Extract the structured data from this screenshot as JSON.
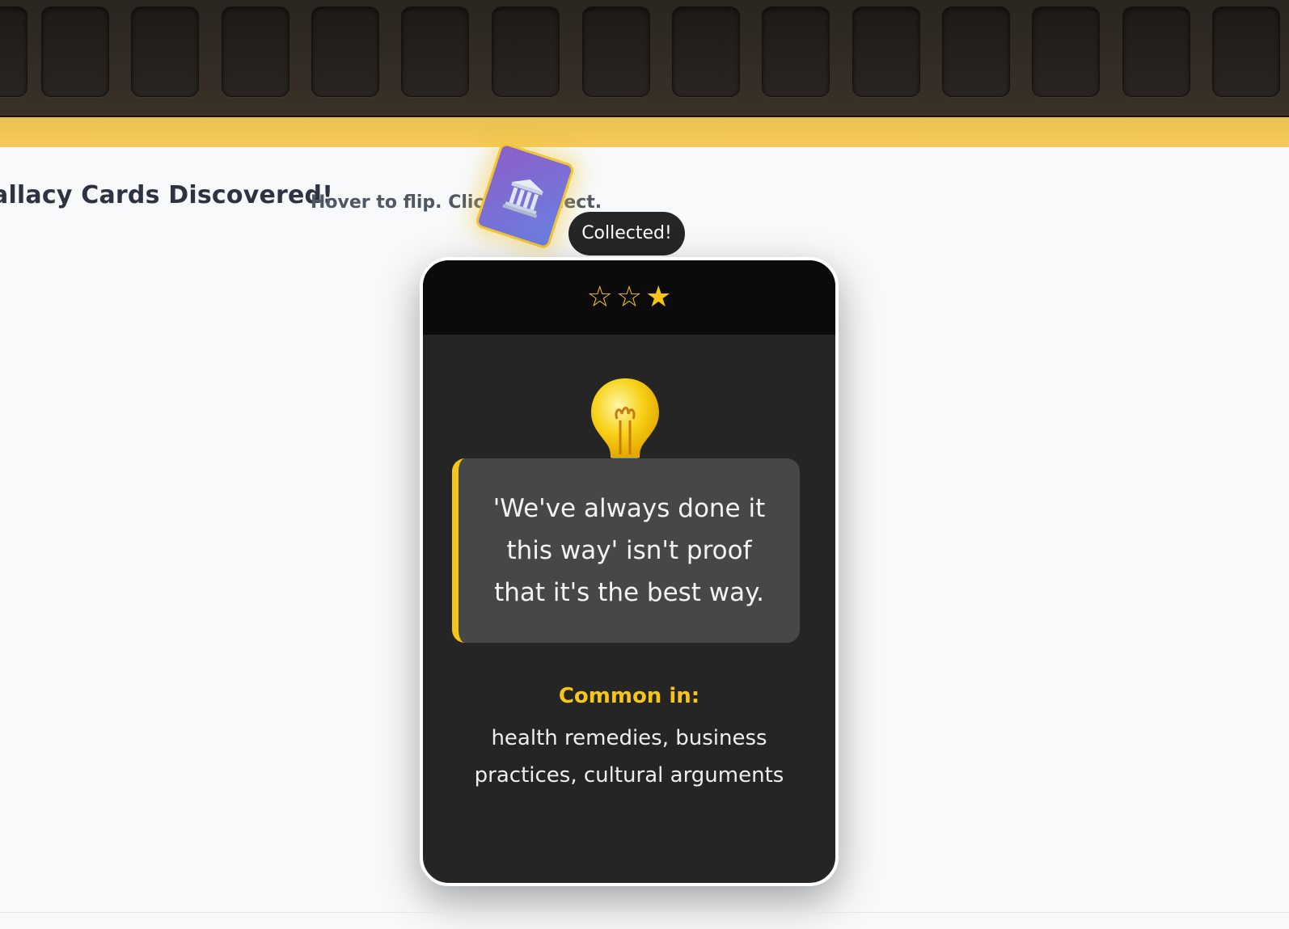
{
  "tray": {
    "slot_count": 15
  },
  "header": {
    "title": "allacy Cards Discovered!",
    "hint": "Hover to flip. Click to collect."
  },
  "mini_card": {
    "icon": "classical-building-icon",
    "accent_color": "#f2c531"
  },
  "tooltip": {
    "text": "Collected!"
  },
  "card": {
    "rating": {
      "filled": 1,
      "total": 3,
      "stars": [
        "☆",
        "☆",
        "★"
      ]
    },
    "icon": "light-bulb-icon",
    "quote": "'We've always done it this way' isn't proof that it's the best way.",
    "common_label": "Common in:",
    "common_text": "health remedies, business practices, cultural arguments",
    "accent_color": "#f5c518"
  }
}
